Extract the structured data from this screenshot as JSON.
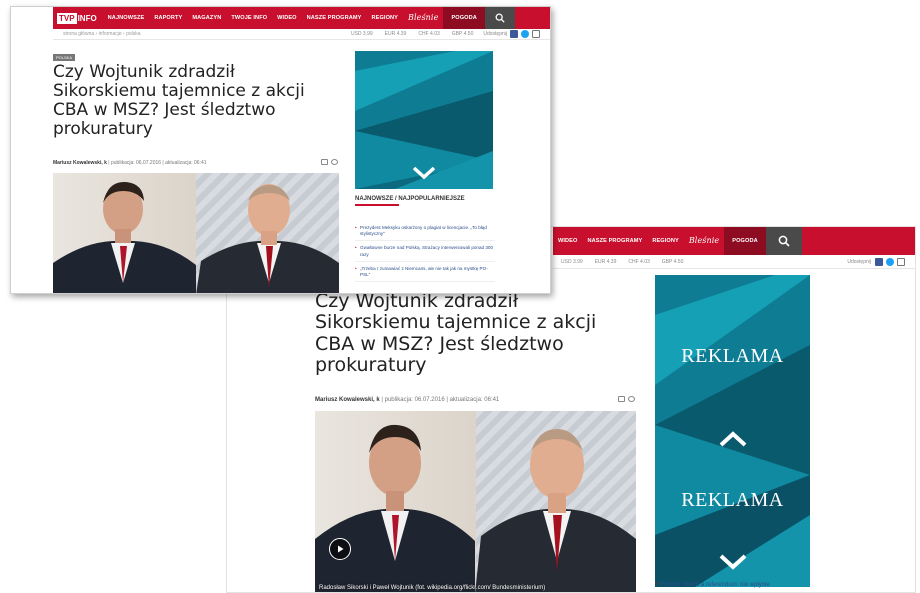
{
  "nav": {
    "logo_tvp": "TVP",
    "logo_info": "INFO",
    "items_a": [
      "NAJNOWSZE",
      "RAPORTY",
      "MAGAZYN",
      "TWOJE INFO",
      "WIDEO",
      "NASZE PROGRAMY",
      "REGIONY"
    ],
    "items_b": [
      "WIDEO",
      "NASZE PROGRAMY",
      "REGIONY"
    ],
    "script_item": "Bleśnie",
    "weather": "POGODA"
  },
  "subbar": {
    "crumbs": "strona główna › informacje › polska",
    "tickers": [
      "USD 3.99",
      "EUR 4.39",
      "CHF 4.03",
      "GBP 4.50"
    ],
    "share_label": "Udostępnij"
  },
  "article": {
    "category": "POLSKA",
    "title": "Czy Wojtunik zdradził Sikorskiemu tajemnice z akcji CBA w MSZ? Jest śledztwo prokuratury",
    "author": "Mariusz Kowalewski, k",
    "published": "publikacja: 06.07.2016",
    "updated": "aktualizacja: 06:41",
    "caption": "Radosław Sikorski i Paweł Wojtunik (fot. wikipedia.org/flickr.com/ Bundesministerium)"
  },
  "ad": {
    "label": "REKLAMA"
  },
  "news": {
    "heading": "NAJNOWSZE / NAJPOPULARNIEJSZE",
    "items": [
      "Prezydent Meksyku oskarżony o plagiat w licencjacie. „To błąd stylistyczny\"",
      "Gwałtowne burze nad Polską. Strażacy interweniowali ponad 300 razy",
      "„Trzeba r zumawiać z Niemcami, ale nie tak jak na mystkę PO-PSL\""
    ],
    "item_b": "Premier Włoch a referendum: nie wpłynie"
  },
  "colors": {
    "brand_red": "#c8102e",
    "ad_teal": "#0a5d73",
    "link_blue": "#2a4f8a"
  }
}
